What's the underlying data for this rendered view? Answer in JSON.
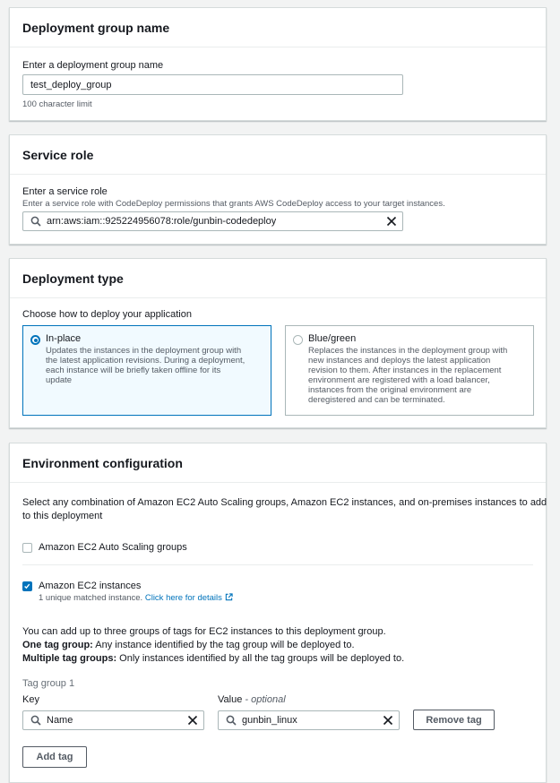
{
  "deployment_group_name": {
    "title": "Deployment group name",
    "label": "Enter a deployment group name",
    "value": "test_deploy_group",
    "hint": "100 character limit"
  },
  "service_role": {
    "title": "Service role",
    "label": "Enter a service role",
    "description": "Enter a service role with CodeDeploy permissions that grants AWS CodeDeploy access to your target instances.",
    "value": "arn:aws:iam::925224956078:role/gunbin-codedeploy"
  },
  "deployment_type": {
    "title": "Deployment type",
    "prompt": "Choose how to deploy your application",
    "options": [
      {
        "label": "In-place",
        "selected": true,
        "desc_lines": [
          "Updates the instances in the deployment group with",
          "the latest application revisions. During a deployment,",
          "each instance will be briefly taken offline for its",
          "update"
        ]
      },
      {
        "label": "Blue/green",
        "selected": false,
        "desc_lines": [
          "Replaces the instances in the deployment group with",
          "new instances and deploys the latest application",
          "revision to them. After instances in the replacement",
          "environment are registered with a load balancer,",
          "instances from the original environment are",
          "deregistered and can be terminated."
        ]
      }
    ]
  },
  "environment": {
    "title": "Environment configuration",
    "intro_lines": [
      "Select any combination of Amazon EC2 Auto Scaling groups, Amazon EC2 instances, and on-premises instances to add",
      "to this deployment"
    ],
    "auto_scaling": {
      "label": "Amazon EC2 Auto Scaling groups",
      "checked": false
    },
    "ec2": {
      "label": "Amazon EC2 instances",
      "checked": true,
      "matched": "1 unique matched instance.",
      "details_link": "Click here for details"
    },
    "tag_info": {
      "line1": "You can add up to three groups of tags for EC2 instances to this deployment group.",
      "one_bold": "One tag group:",
      "one_rest": " Any instance identified by the tag group will be deployed to.",
      "multi_bold": "Multiple tag groups:",
      "multi_rest": " Only instances identified by all the tag groups will be deployed to."
    },
    "tag_group": {
      "title": "Tag group 1",
      "key_label": "Key",
      "value_label": "Value",
      "value_optional": " - optional",
      "key": "Name",
      "value": "gunbin_linux",
      "remove_button": "Remove tag"
    },
    "add_tag_button": "Add tag"
  },
  "colors": {
    "accent": "#0073bb",
    "border": "#aab7b8",
    "background": "#f2f3f3"
  },
  "icons": [
    "search-icon",
    "close-icon",
    "external-link-icon",
    "check-icon"
  ]
}
